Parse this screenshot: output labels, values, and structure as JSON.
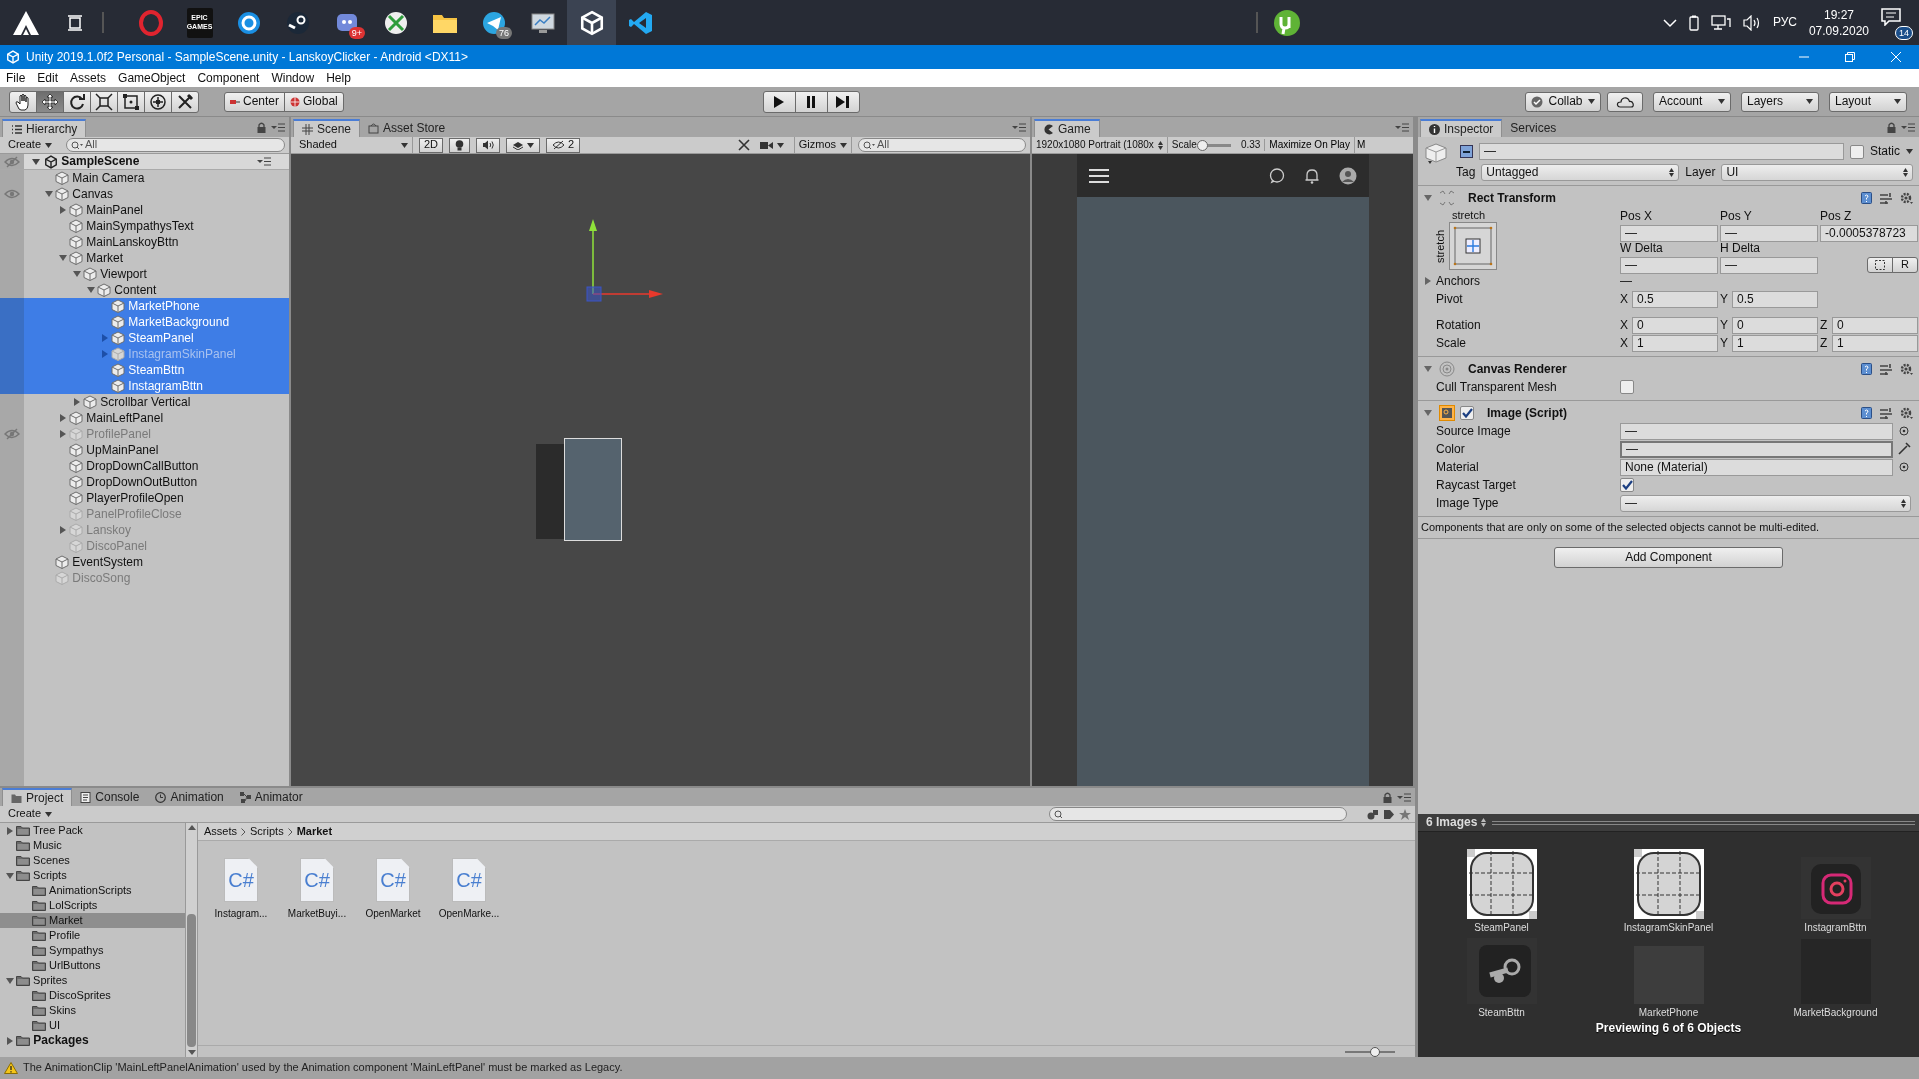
{
  "taskbar": {
    "apps": [
      {
        "kind": "ring",
        "selected": false
      },
      {
        "kind": "epic",
        "label": "EPIC GAMES",
        "selected": false
      },
      {
        "kind": "swirl",
        "selected": false
      },
      {
        "kind": "steam",
        "selected": false
      },
      {
        "kind": "chat",
        "badge": "9+",
        "selected": false
      },
      {
        "kind": "xbox",
        "selected": false
      },
      {
        "kind": "folder",
        "selected": false
      },
      {
        "kind": "plane",
        "badge": "76",
        "selected": false
      },
      {
        "kind": "monitor",
        "selected": false
      },
      {
        "kind": "unity",
        "selected": true
      },
      {
        "kind": "code",
        "selected": false
      }
    ],
    "pinned": [
      {
        "kind": "torrent",
        "selected": false
      }
    ],
    "tray": {
      "language": "РУС",
      "time": "19:27",
      "date": "07.09.2020",
      "notifications": "14"
    }
  },
  "window": {
    "title": "Unity 2019.1.0f2 Personal - SampleScene.unity - LanskoyClicker - Android <DX11>"
  },
  "menu": [
    "File",
    "Edit",
    "Assets",
    "GameObject",
    "Component",
    "Window",
    "Help"
  ],
  "toolbar": {
    "tools": [
      {
        "kind": "hand",
        "selected": false
      },
      {
        "kind": "move",
        "selected": true
      },
      {
        "kind": "rotate",
        "selected": false
      },
      {
        "kind": "scale",
        "selected": false
      },
      {
        "kind": "rect",
        "selected": false
      },
      {
        "kind": "transform",
        "selected": false
      },
      {
        "kind": "custom",
        "selected": false
      }
    ],
    "pivot_buttons": [
      "Center",
      "Global"
    ],
    "right_buttons": [
      {
        "kind": "dropdown",
        "label": "Collab"
      },
      {
        "kind": "cloud"
      },
      {
        "kind": "dropdown",
        "label": "Account"
      },
      {
        "kind": "dropdown",
        "label": "Layers"
      },
      {
        "kind": "dropdown",
        "label": "Layout"
      }
    ]
  },
  "hierarchy": {
    "tab": "Hierarchy",
    "create": "Create",
    "search_placeholder": "All",
    "scene": {
      "label": "SampleScene",
      "eye_hidden": true,
      "expanded": true
    },
    "items": [
      {
        "label": "Main Camera",
        "selected": false,
        "inactive": false
      },
      {
        "label": "Canvas",
        "eye_hidden": false,
        "expanded": true,
        "selected": false,
        "inactive": false,
        "children": [
          {
            "label": "MainPanel",
            "expanded": false,
            "selected": false,
            "inactive": false
          },
          {
            "label": "MainSympathysText",
            "selected": false,
            "inactive": false
          },
          {
            "label": "MainLanskoyBttn",
            "selected": false,
            "inactive": false
          },
          {
            "label": "Market",
            "expanded": true,
            "selected": false,
            "inactive": false,
            "children": [
              {
                "label": "Viewport",
                "expanded": true,
                "selected": false,
                "inactive": false,
                "children": [
                  {
                    "label": "Content",
                    "expanded": true,
                    "selected": false,
                    "inactive": false,
                    "children": [
                      {
                        "label": "MarketPhone",
                        "selected": true,
                        "inactive": false
                      },
                      {
                        "label": "MarketBackground",
                        "selected": true,
                        "inactive": false
                      },
                      {
                        "label": "SteamPanel",
                        "expanded": false,
                        "selected": true,
                        "inactive": false
                      },
                      {
                        "label": "InstagramSkinPanel",
                        "expanded": false,
                        "selected": true,
                        "inactive": true
                      },
                      {
                        "label": "SteamBttn",
                        "selected": true,
                        "inactive": false
                      },
                      {
                        "label": "InstagramBttn",
                        "selected": true,
                        "inactive": false
                      }
                    ]
                  }
                ]
              },
              {
                "label": "Scrollbar Vertical",
                "expanded": false,
                "selected": false,
                "inactive": false
              }
            ]
          },
          {
            "label": "MainLeftPanel",
            "expanded": false,
            "selected": false,
            "inactive": false
          },
          {
            "label": "ProfilePanel",
            "eye_hidden": true,
            "expanded": false,
            "selected": false,
            "inactive": true
          },
          {
            "label": "UpMainPanel",
            "selected": false,
            "inactive": false
          },
          {
            "label": "DropDownCallButton",
            "selected": false,
            "inactive": false
          },
          {
            "label": "DropDownOutButton",
            "selected": false,
            "inactive": false
          },
          {
            "label": "PlayerProfileOpen",
            "selected": false,
            "inactive": false
          },
          {
            "label": "PanelProfileClose",
            "selected": false,
            "inactive": true
          },
          {
            "label": "Lanskoy",
            "expanded": false,
            "selected": false,
            "inactive": true
          },
          {
            "label": "DiscoPanel",
            "selected": false,
            "inactive": true
          }
        ]
      },
      {
        "label": "EventSystem",
        "selected": false,
        "inactive": false
      },
      {
        "label": "DiscoSong",
        "selected": false,
        "inactive": true
      }
    ]
  },
  "scene_view": {
    "tabs": [
      {
        "label": "Scene",
        "kind": "scene",
        "selected": true
      },
      {
        "label": "Asset Store",
        "kind": "store",
        "selected": false
      }
    ],
    "shading": "Shaded",
    "mode_2d": "2D",
    "hidden_count": "2",
    "gizmos": "Gizmos",
    "search_placeholder": "All"
  },
  "game_view": {
    "tab": "Game",
    "resolution": "1920x1080 Portrait (1080x",
    "scale_label": "Scale",
    "scale": {
      "level": 0.05
    },
    "scale_value": "0.33",
    "maximize": "Maximize On Play",
    "cut_button": "M"
  },
  "inspector": {
    "tabs": [
      {
        "label": "Inspector",
        "kind": "info",
        "selected": true
      },
      {
        "label": "Services",
        "kind": "none",
        "selected": false
      }
    ],
    "object": {
      "name": "—",
      "static_label": "Static",
      "static": false,
      "tag_label": "Tag",
      "tag": "Untagged",
      "layer_label": "Layer",
      "layer": "UI"
    },
    "rect_transform": {
      "title": "Rect Transform",
      "expanded": true,
      "anchor_h": "stretch",
      "anchor_v": "stretch",
      "fields": [
        {
          "label": "Pos X",
          "value": "—"
        },
        {
          "label": "Pos Y",
          "value": "—"
        },
        {
          "label": "Pos Z",
          "value": "-0.0005378723"
        },
        {
          "label": "W Delta",
          "value": "—"
        },
        {
          "label": "H Delta",
          "value": "—"
        }
      ],
      "raw_button": "R",
      "anchors": {
        "label": "Anchors",
        "value": "—"
      },
      "vectors": [
        {
          "label": "Pivot",
          "axes": [
            {
              "axis": "X",
              "value": "0.5"
            },
            {
              "axis": "Y",
              "value": "0.5"
            }
          ]
        },
        {
          "label": "Rotation",
          "axes": [
            {
              "axis": "X",
              "value": "0"
            },
            {
              "axis": "Y",
              "value": "0"
            },
            {
              "axis": "Z",
              "value": "0"
            }
          ]
        },
        {
          "label": "Scale",
          "axes": [
            {
              "axis": "X",
              "value": "1"
            },
            {
              "axis": "Y",
              "value": "1"
            },
            {
              "axis": "Z",
              "value": "1"
            }
          ]
        }
      ]
    },
    "components": [
      {
        "kind": "renderer",
        "title": "Canvas Renderer",
        "expanded": true,
        "properties": [
          {
            "label": "Cull Transparent Mesh",
            "kind": "checkbox",
            "checked": false
          }
        ]
      },
      {
        "kind": "image",
        "title": "Image (Script)",
        "expanded": true,
        "enabled": true,
        "properties": [
          {
            "label": "Source Image",
            "kind": "object",
            "value": "—"
          },
          {
            "label": "Color",
            "kind": "color",
            "value": "—"
          },
          {
            "label": "Material",
            "kind": "object",
            "value": "None (Material)"
          },
          {
            "label": "Raycast Target",
            "kind": "checkbox",
            "checked": true
          },
          {
            "label": "Image Type",
            "kind": "dropdown",
            "value": "—"
          }
        ]
      }
    ],
    "note": "Components that are only on some of the selected objects cannot be multi-edited.",
    "add_component": "Add Component",
    "preview": {
      "title": "6 Images",
      "items": [
        {
          "label": "SteamPanel",
          "kind": "sliced"
        },
        {
          "label": "InstagramSkinPanel",
          "kind": "sliced"
        },
        {
          "label": "InstagramBttn",
          "kind": "camera"
        },
        {
          "label": "SteamBttn",
          "kind": "steam"
        },
        {
          "label": "MarketPhone",
          "kind": "blank"
        },
        {
          "label": "MarketBackground",
          "kind": "dark"
        }
      ],
      "caption": "Previewing 6 of 6 Objects"
    }
  },
  "project": {
    "tabs": [
      {
        "label": "Project",
        "kind": "folder",
        "selected": true
      },
      {
        "label": "Console",
        "kind": "console",
        "selected": false
      },
      {
        "label": "Animation",
        "kind": "clock",
        "selected": false
      },
      {
        "label": "Animator",
        "kind": "nodes",
        "selected": false
      }
    ],
    "create": "Create",
    "folders": [
      {
        "label": "Tree Pack",
        "expanded": false,
        "selected": false
      },
      {
        "label": "Music",
        "selected": false
      },
      {
        "label": "Scenes",
        "selected": false
      },
      {
        "label": "Scripts",
        "expanded": true,
        "selected": false,
        "children": [
          {
            "label": "AnimationScripts",
            "selected": false
          },
          {
            "label": "LolScripts",
            "selected": false
          },
          {
            "label": "Market",
            "selected": true
          },
          {
            "label": "Profile",
            "selected": false
          },
          {
            "label": "Sympathys",
            "selected": false
          },
          {
            "label": "UrlButtons",
            "selected": false
          }
        ]
      },
      {
        "label": "Sprites",
        "expanded": true,
        "selected": false,
        "children": [
          {
            "label": "DiscoSprites",
            "selected": false
          },
          {
            "label": "Skins",
            "selected": false
          },
          {
            "label": "UI",
            "selected": false
          }
        ]
      },
      {
        "label": "Packages",
        "kind": "root",
        "expanded": false,
        "selected": false
      }
    ],
    "breadcrumb": [
      "Assets",
      "Scripts",
      "Market"
    ],
    "files": [
      {
        "label": "Instagram...",
        "icon_text": "C#"
      },
      {
        "label": "MarketBuyi...",
        "icon_text": "C#"
      },
      {
        "label": "OpenMarket",
        "icon_text": "C#"
      },
      {
        "label": "OpenMarke...",
        "icon_text": "C#"
      }
    ],
    "zoom": {
      "level": 0.6
    }
  },
  "status_bar": {
    "message": "The AnimationClip 'MainLeftPanelAnimation' used by the Animation component 'MainLeftPanel' must be marked as Legacy."
  }
}
